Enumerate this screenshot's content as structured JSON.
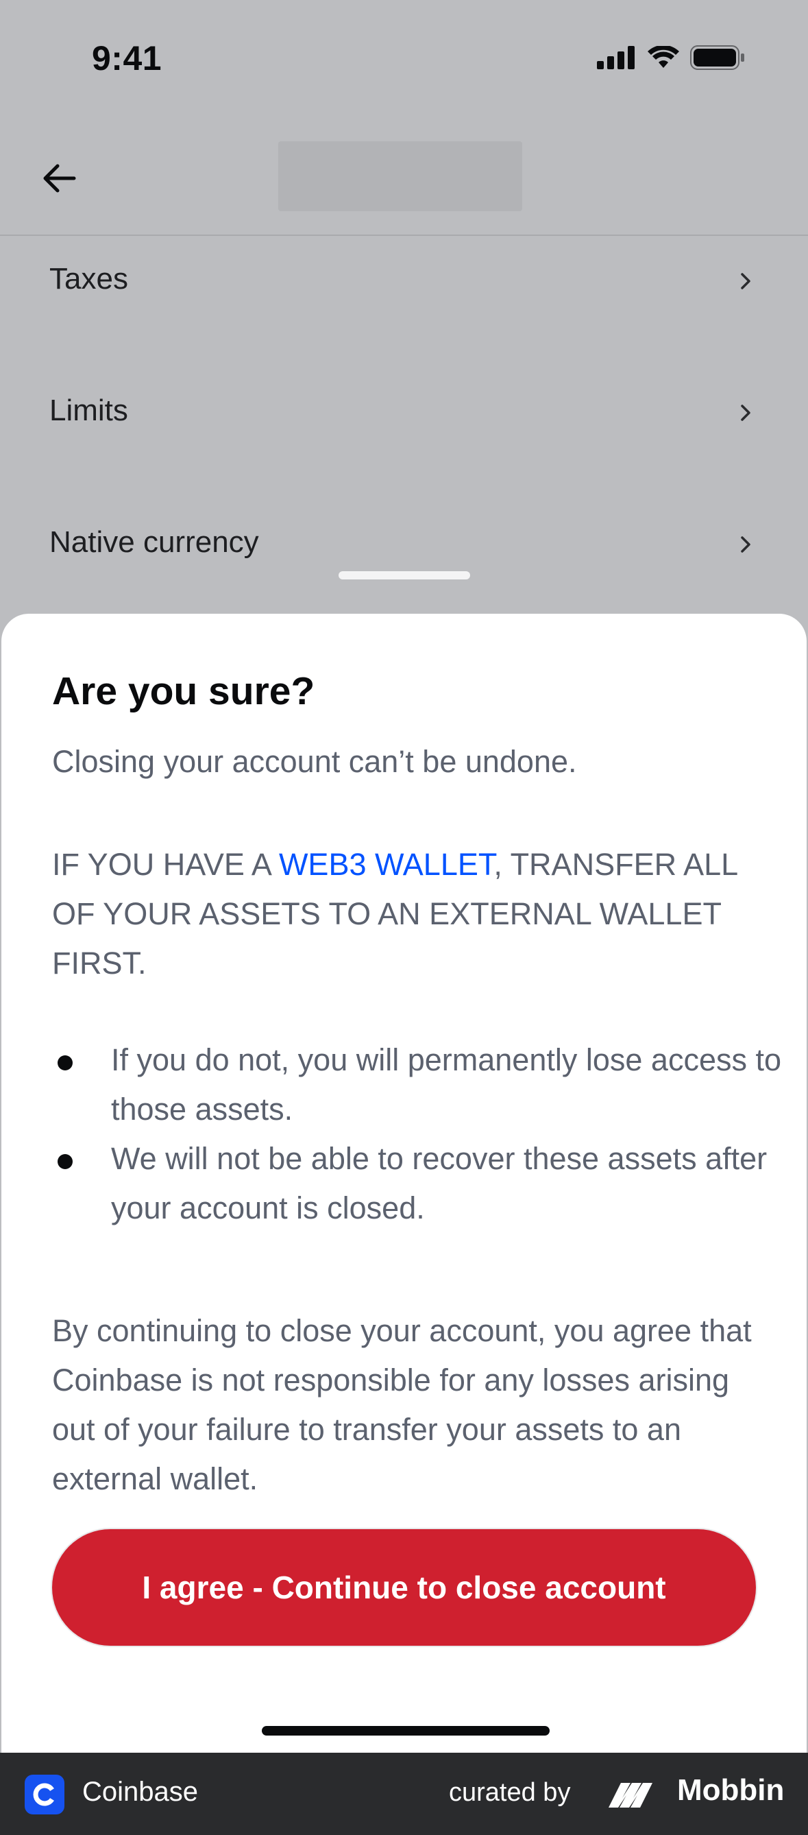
{
  "status_bar": {
    "time": "9:41"
  },
  "settings": {
    "items": [
      {
        "label": "Taxes"
      },
      {
        "label": "Limits"
      },
      {
        "label": "Native currency"
      }
    ]
  },
  "sheet": {
    "title": "Are you sure?",
    "subtitle": "Closing your account can’t be undone.",
    "warning_prefix": "IF YOU HAVE A ",
    "warning_link": "WEB3 WALLET",
    "warning_suffix": ", TRANSFER ALL OF YOUR ASSETS TO AN EXTERNAL WALLET FIRST.",
    "bullets": [
      "If you do not, you will permanently lose access to those assets.",
      "We will not be able to recover these assets after your account is closed."
    ],
    "disclaimer": "By continuing to close your account, you agree that Coinbase is not responsible for any losses arising out of your failure to transfer your assets to an external wallet.",
    "agree_button": "I agree - Continue to close account"
  },
  "footer": {
    "app_name": "Coinbase",
    "curated_by": "curated by",
    "brand": "Mobbin"
  },
  "colors": {
    "accent_red": "#cf202f",
    "link_blue": "#0052ff",
    "coinbase_blue": "#1652f0"
  }
}
